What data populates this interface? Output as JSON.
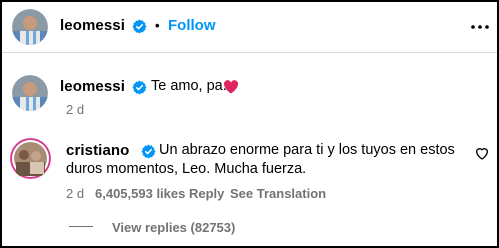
{
  "header": {
    "username": "leomessi",
    "separator": "•",
    "follow_label": "Follow"
  },
  "comments": [
    {
      "username": "leomessi",
      "text": "Te amo, pa.",
      "emoji": "heart",
      "time": "2 d"
    },
    {
      "username": "cristiano",
      "text_line1": "Un abrazo enorme para ti y los tuyos en estos",
      "text_line2": "duros momentos, Leo. Mucha fuerza.",
      "time": "2 d",
      "likes": "6,405,593 likes",
      "reply_label": "Reply",
      "translation_label": "See Translation",
      "view_replies": "View replies (82753)"
    }
  ],
  "colors": {
    "accent": "#0095f6",
    "verified": "#0095f6",
    "heart": "#e0245e",
    "muted": "#737373",
    "divider": "#dbdbdb"
  },
  "icons": {
    "verified": "verified-badge-icon",
    "heart": "heart-emoji-icon",
    "like": "heart-outline-icon",
    "more": "more-options-icon"
  }
}
